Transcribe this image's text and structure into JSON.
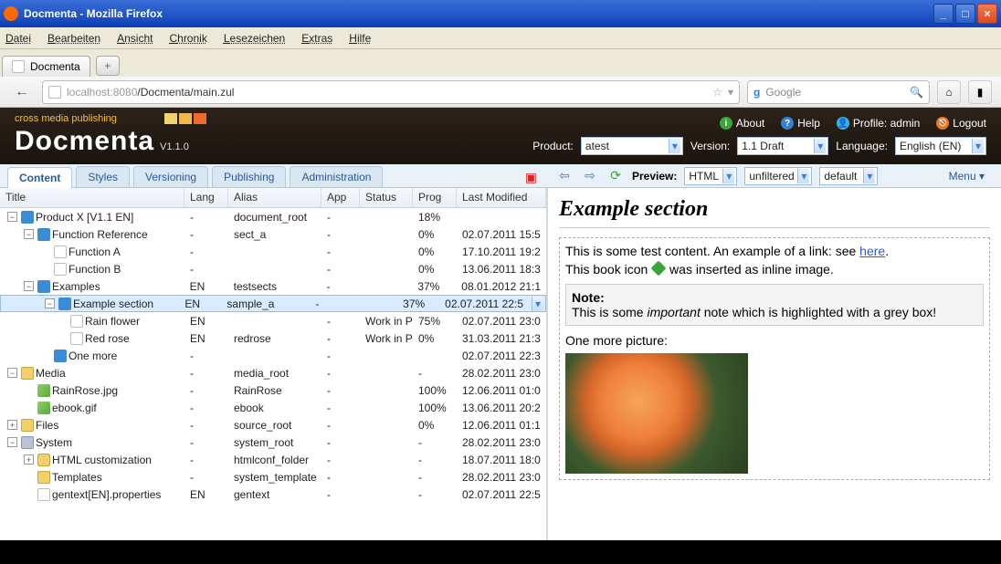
{
  "window": {
    "title": "Docmenta - Mozilla Firefox"
  },
  "menubar": [
    "Datei",
    "Bearbeiten",
    "Ansicht",
    "Chronik",
    "Lesezeichen",
    "Extras",
    "Hilfe"
  ],
  "browsertab": "Docmenta",
  "url": {
    "host": "localhost:8080",
    "path": "/Docmenta/main.zul"
  },
  "search_placeholder": "Google",
  "header": {
    "tagline": "cross media publishing",
    "brand": "Docmenta",
    "version": "V1.1.0",
    "links": {
      "about": "About",
      "help": "Help",
      "profile": "Profile: admin",
      "logout": "Logout"
    },
    "product_label": "Product:",
    "product_value": "atest",
    "version_label": "Version:",
    "version_value": "1.1 Draft",
    "language_label": "Language:",
    "language_value": "English (EN)"
  },
  "apptabs": [
    "Content",
    "Styles",
    "Versioning",
    "Publishing",
    "Administration"
  ],
  "rightbar": {
    "preview_label": "Preview:",
    "sel1": "HTML",
    "sel2": "unfiltered",
    "sel3": "default",
    "menu": "Menu"
  },
  "cols": {
    "title": "Title",
    "lang": "Lang",
    "alias": "Alias",
    "app": "App",
    "status": "Status",
    "prog": "Prog",
    "last": "Last Modified"
  },
  "rows": [
    {
      "indent": 0,
      "toggle": "−",
      "icon": "book",
      "title": "Product X [V1.1 EN]",
      "lang": "-",
      "alias": "document_root",
      "app": "-",
      "status": "",
      "prog": "18%",
      "last": ""
    },
    {
      "indent": 1,
      "toggle": "−",
      "icon": "book",
      "title": "Function Reference",
      "lang": "-",
      "alias": "sect_a",
      "app": "-",
      "status": "",
      "prog": "0%",
      "last": "02.07.2011 15:5"
    },
    {
      "indent": 2,
      "toggle": "",
      "icon": "page",
      "title": "Function A",
      "lang": "-",
      "alias": "",
      "app": "-",
      "status": "",
      "prog": "0%",
      "last": "17.10.2011 19:2"
    },
    {
      "indent": 2,
      "toggle": "",
      "icon": "page",
      "title": "Function B",
      "lang": "-",
      "alias": "",
      "app": "-",
      "status": "",
      "prog": "0%",
      "last": "13.06.2011 18:3"
    },
    {
      "indent": 1,
      "toggle": "−",
      "icon": "book",
      "title": "Examples",
      "lang": "EN",
      "alias": "testsects",
      "app": "-",
      "status": "",
      "prog": "37%",
      "last": "08.01.2012 21:1"
    },
    {
      "indent": 2,
      "toggle": "−",
      "icon": "book",
      "title": "Example section",
      "lang": "EN",
      "alias": "sample_a",
      "app": "-",
      "status": "",
      "prog": "37%",
      "last": "02.07.2011 22:5",
      "sel": true
    },
    {
      "indent": 3,
      "toggle": "",
      "icon": "page",
      "title": "Rain flower",
      "lang": "EN",
      "alias": "",
      "app": "-",
      "status": "Work in P",
      "prog": "75%",
      "last": "02.07.2011 23:0"
    },
    {
      "indent": 3,
      "toggle": "",
      "icon": "page",
      "title": "Red rose",
      "lang": "EN",
      "alias": "redrose",
      "app": "-",
      "status": "Work in P",
      "prog": "0%",
      "last": "31.03.2011 21:3"
    },
    {
      "indent": 2,
      "toggle": "",
      "icon": "book",
      "title": "One more",
      "lang": "-",
      "alias": "",
      "app": "-",
      "status": "",
      "prog": "",
      "last": "02.07.2011 22:3"
    },
    {
      "indent": 0,
      "toggle": "−",
      "icon": "folder",
      "title": "Media",
      "lang": "-",
      "alias": "media_root",
      "app": "-",
      "status": "",
      "prog": "-",
      "last": "28.02.2011 23:0"
    },
    {
      "indent": 1,
      "toggle": "",
      "icon": "img",
      "title": "RainRose.jpg",
      "lang": "-",
      "alias": "RainRose",
      "app": "-",
      "status": "",
      "prog": "100%",
      "last": "12.06.2011 01:0"
    },
    {
      "indent": 1,
      "toggle": "",
      "icon": "img",
      "title": "ebook.gif",
      "lang": "-",
      "alias": "ebook",
      "app": "-",
      "status": "",
      "prog": "100%",
      "last": "13.06.2011 20:2"
    },
    {
      "indent": 0,
      "toggle": "+",
      "icon": "folder",
      "title": "Files",
      "lang": "-",
      "alias": "source_root",
      "app": "-",
      "status": "",
      "prog": "0%",
      "last": "12.06.2011 01:1"
    },
    {
      "indent": 0,
      "toggle": "−",
      "icon": "gear",
      "title": "System",
      "lang": "-",
      "alias": "system_root",
      "app": "-",
      "status": "",
      "prog": "-",
      "last": "28.02.2011 23:0"
    },
    {
      "indent": 1,
      "toggle": "+",
      "icon": "folder",
      "title": "HTML customization",
      "lang": "-",
      "alias": "htmlconf_folder",
      "app": "-",
      "status": "",
      "prog": "-",
      "last": "18.07.2011 18:0"
    },
    {
      "indent": 1,
      "toggle": "",
      "icon": "folder",
      "title": "Templates",
      "lang": "-",
      "alias": "system_template",
      "app": "-",
      "status": "",
      "prog": "-",
      "last": "28.02.2011 23:0"
    },
    {
      "indent": 1,
      "toggle": "",
      "icon": "page",
      "title": "gentext[EN].properties",
      "lang": "EN",
      "alias": "gentext",
      "app": "-",
      "status": "",
      "prog": "-",
      "last": "02.07.2011 22:5"
    }
  ],
  "preview": {
    "title": "Example section",
    "line1_pre": "This is some test content. An example of a link: see ",
    "line1_link": "here",
    "line1_post": ".",
    "line2a": "This book icon ",
    "line2b": " was inserted as inline image.",
    "note_label": "Note:",
    "note_body_a": "This is some ",
    "note_body_em": "important",
    "note_body_b": " note which is highlighted with a grey box!",
    "pic_label": "One more picture:"
  }
}
